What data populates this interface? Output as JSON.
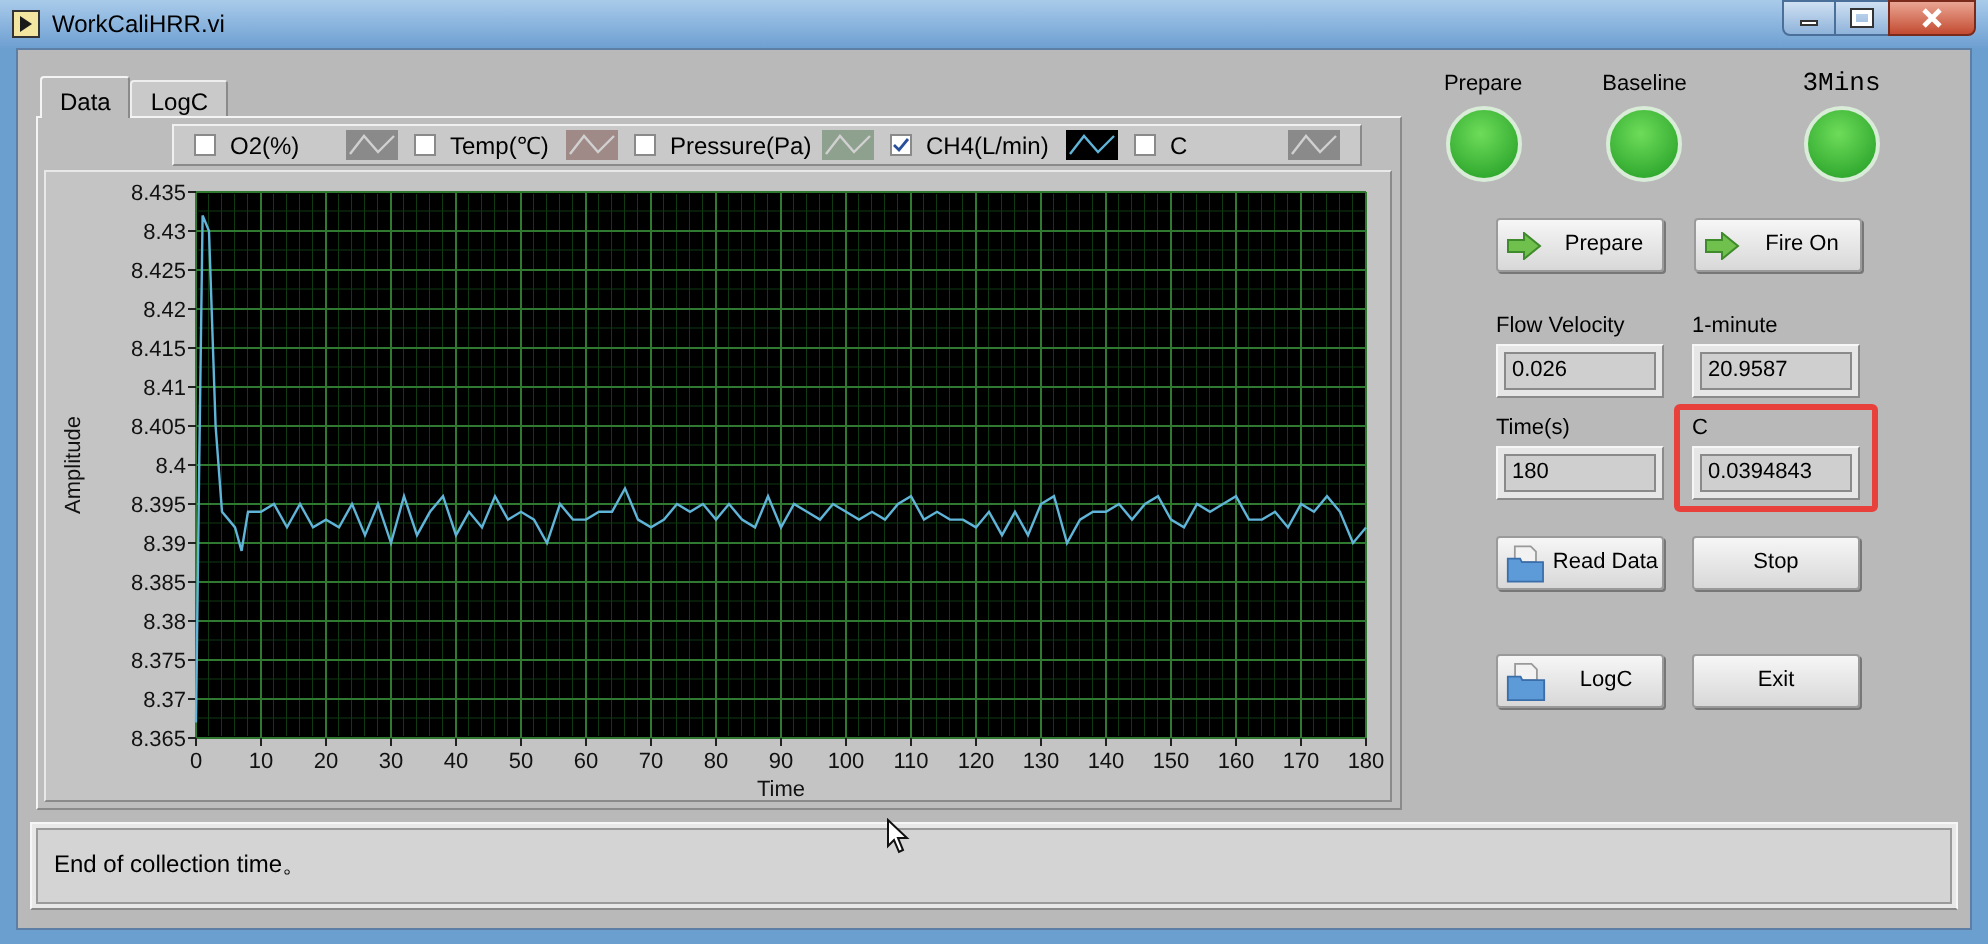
{
  "window": {
    "title": "WorkCaliHRR.vi"
  },
  "tabs": [
    {
      "label": "Data",
      "selected": true
    },
    {
      "label": "LogC",
      "selected": false
    }
  ],
  "legend": [
    {
      "label": "O2(%)",
      "checked": false,
      "color": "#8a8a8a"
    },
    {
      "label": "Temp(℃)",
      "checked": false,
      "color": "#a08a88"
    },
    {
      "label": "Pressure(Pa)",
      "checked": false,
      "color": "#8ea08e"
    },
    {
      "label": "CH4(L/min)",
      "checked": true,
      "color": "#000000"
    },
    {
      "label": "C",
      "checked": false,
      "color": "#8a8a8a"
    }
  ],
  "chart": {
    "chart_data": {
      "type": "line",
      "grid": true,
      "xlabel": "Time",
      "ylabel": "Amplitude",
      "xlim": [
        0,
        180
      ],
      "ylim": [
        8.365,
        8.435
      ],
      "xticks": [
        0,
        10,
        20,
        30,
        40,
        50,
        60,
        70,
        80,
        90,
        100,
        110,
        120,
        130,
        140,
        150,
        160,
        170,
        180
      ],
      "yticks": [
        8.365,
        8.37,
        8.375,
        8.38,
        8.385,
        8.39,
        8.395,
        8.4,
        8.405,
        8.41,
        8.415,
        8.42,
        8.425,
        8.43,
        8.435
      ],
      "x": [
        0,
        0.5,
        1,
        2,
        3,
        4,
        5,
        6,
        7,
        8,
        10,
        12,
        14,
        16,
        18,
        20,
        22,
        24,
        26,
        28,
        30,
        32,
        34,
        36,
        38,
        40,
        42,
        44,
        46,
        48,
        50,
        52,
        54,
        56,
        58,
        60,
        62,
        64,
        66,
        68,
        70,
        72,
        74,
        76,
        78,
        80,
        82,
        84,
        86,
        88,
        90,
        92,
        94,
        96,
        98,
        100,
        102,
        104,
        106,
        108,
        110,
        112,
        114,
        116,
        118,
        120,
        122,
        124,
        126,
        128,
        130,
        132,
        134,
        136,
        138,
        140,
        142,
        144,
        146,
        148,
        150,
        152,
        154,
        156,
        158,
        160,
        162,
        164,
        166,
        168,
        170,
        172,
        174,
        176,
        178,
        180
      ],
      "series": [
        {
          "color": "#5fb4d8",
          "values": [
            8.367,
            8.4,
            8.432,
            8.43,
            8.405,
            8.394,
            8.393,
            8.392,
            8.389,
            8.394,
            8.394,
            8.395,
            8.392,
            8.395,
            8.392,
            8.393,
            8.392,
            8.395,
            8.391,
            8.395,
            8.39,
            8.396,
            8.391,
            8.394,
            8.396,
            8.391,
            8.394,
            8.392,
            8.396,
            8.393,
            8.394,
            8.393,
            8.39,
            8.395,
            8.393,
            8.393,
            8.394,
            8.394,
            8.397,
            8.393,
            8.392,
            8.393,
            8.395,
            8.394,
            8.395,
            8.393,
            8.395,
            8.393,
            8.392,
            8.396,
            8.392,
            8.395,
            8.394,
            8.393,
            8.395,
            8.394,
            8.393,
            8.394,
            8.393,
            8.395,
            8.396,
            8.393,
            8.394,
            8.393,
            8.393,
            8.392,
            8.394,
            8.391,
            8.394,
            8.391,
            8.395,
            8.396,
            8.39,
            8.393,
            8.394,
            8.394,
            8.395,
            8.393,
            8.395,
            8.396,
            8.393,
            8.392,
            8.395,
            8.394,
            8.395,
            8.396,
            8.393,
            8.393,
            8.394,
            8.392,
            8.395,
            8.394,
            8.396,
            8.394,
            8.39,
            8.392
          ]
        }
      ]
    }
  },
  "indicators": [
    {
      "label": "Prepare",
      "on": true
    },
    {
      "label": "Baseline",
      "on": true
    },
    {
      "label": "3Mins",
      "on": true
    }
  ],
  "action_buttons": [
    {
      "label": "Prepare",
      "kind": "arrow"
    },
    {
      "label": "Fire On",
      "kind": "arrow"
    }
  ],
  "fields": [
    {
      "label": "Flow Velocity",
      "value": "0.026",
      "highlighted": false
    },
    {
      "label": "1-minute",
      "value": "20.9587",
      "highlighted": false
    },
    {
      "label": "Time(s)",
      "value": "180",
      "highlighted": false
    },
    {
      "label": "C",
      "value": "0.0394843",
      "highlighted": true
    }
  ],
  "bottom_buttons": [
    {
      "label": "Read Data",
      "kind": "file"
    },
    {
      "label": "Stop",
      "kind": "plain"
    },
    {
      "label": "LogC",
      "kind": "file"
    },
    {
      "label": "Exit",
      "kind": "plain"
    }
  ],
  "status_bar": {
    "text": "End of collection time。"
  }
}
